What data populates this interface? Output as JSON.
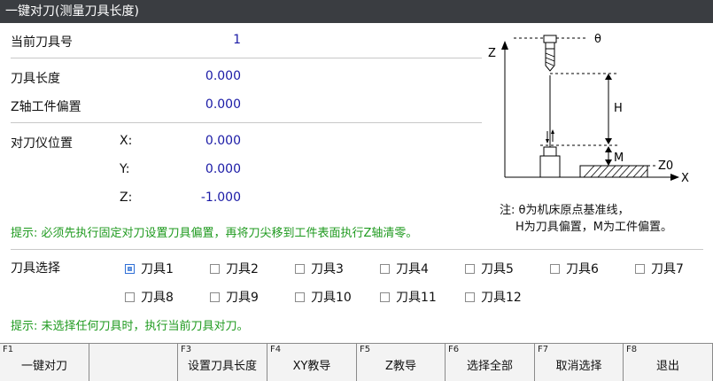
{
  "title": "一键对刀(测量刀具长度)",
  "current_tool": {
    "label": "当前刀具号",
    "value": "1"
  },
  "tool_length": {
    "label": "刀具长度",
    "value": "0.000"
  },
  "z_offset": {
    "label": "Z轴工件偏置",
    "value": "0.000"
  },
  "setter_position": {
    "label": "对刀仪位置",
    "x": {
      "label": "X:",
      "value": "0.000"
    },
    "y": {
      "label": "Y:",
      "value": "0.000"
    },
    "z": {
      "label": "Z:",
      "value": "-1.000"
    }
  },
  "hint1": "提示: 必须先执行固定对刀设置刀具偏置，再将刀尖移到工件表面执行Z轴清零。",
  "tool_select": {
    "label": "刀具选择",
    "tools": [
      {
        "label": "刀具1",
        "checked": true
      },
      {
        "label": "刀具2",
        "checked": false
      },
      {
        "label": "刀具3",
        "checked": false
      },
      {
        "label": "刀具4",
        "checked": false
      },
      {
        "label": "刀具5",
        "checked": false
      },
      {
        "label": "刀具6",
        "checked": false
      },
      {
        "label": "刀具7",
        "checked": false
      },
      {
        "label": "刀具8",
        "checked": false
      },
      {
        "label": "刀具9",
        "checked": false
      },
      {
        "label": "刀具10",
        "checked": false
      },
      {
        "label": "刀具11",
        "checked": false
      },
      {
        "label": "刀具12",
        "checked": false
      }
    ]
  },
  "hint2": "提示: 未选择任何刀具时，执行当前刀具对刀。",
  "diagram": {
    "theta": "θ",
    "z_axis": "Z",
    "x_axis": "X",
    "h": "H",
    "m": "M",
    "z0": "Z0"
  },
  "note": {
    "line1": "注: θ为机床原点基准线，",
    "line2": "H为刀具偏置，M为工件偏置。"
  },
  "fkeys": [
    {
      "num": "F1",
      "label": "一键对刀"
    },
    {
      "num": "",
      "label": ""
    },
    {
      "num": "F3",
      "label": "设置刀具长度"
    },
    {
      "num": "F4",
      "label": "XY教导"
    },
    {
      "num": "F5",
      "label": "Z教导"
    },
    {
      "num": "F6",
      "label": "选择全部"
    },
    {
      "num": "F7",
      "label": "取消选择"
    },
    {
      "num": "F8",
      "label": "退出"
    }
  ]
}
